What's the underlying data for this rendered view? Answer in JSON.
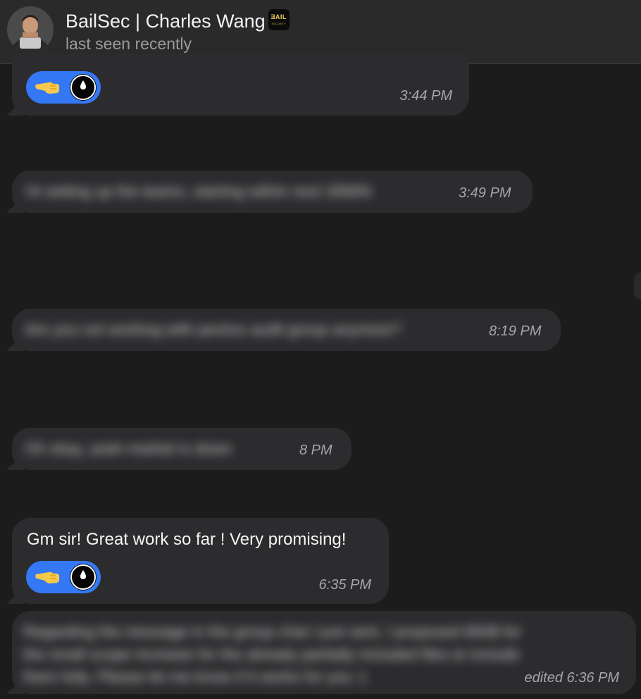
{
  "header": {
    "title": "BailSec | Charles Wang",
    "status": "last seen recently",
    "badge_text": "ƎAIL",
    "badge_sub": "SECURITY"
  },
  "messages": [
    {
      "id": "m1",
      "has_reaction": true,
      "time": "3:44 PM"
    },
    {
      "id": "m2",
      "blurred": true,
      "text": "Hi setting up the teams, starting within next 30MIN",
      "time": "3:49 PM"
    },
    {
      "id": "m3",
      "blurred": true,
      "text": "Are you not working with peckss audit group anymore?",
      "time": "8:19 PM"
    },
    {
      "id": "m4",
      "blurred": true,
      "text": "Oh okay, yeah market is down",
      "time": "8 PM"
    },
    {
      "id": "m5",
      "text": "Gm sir! Great work so far ! Very promising!",
      "has_reaction": true,
      "time": "6:35 PM"
    },
    {
      "id": "m6",
      "blurred": true,
      "lines": [
        "Regarding the message in the group chat I just sent, I proposed 800$ for",
        "the small scope increase for the already partially included files to include",
        "them fully. Please let me know if it works for you :)"
      ],
      "time": "edited 6:36 PM"
    }
  ],
  "colors": {
    "background": "#1c1c1d",
    "bubble": "#2c2c2e",
    "reaction": "#3478f6",
    "header": "#2a2a2b"
  },
  "icons": {
    "reaction_emoji": "pointing-hand-emoji",
    "reaction_user": "reactor-avatar-icon"
  }
}
